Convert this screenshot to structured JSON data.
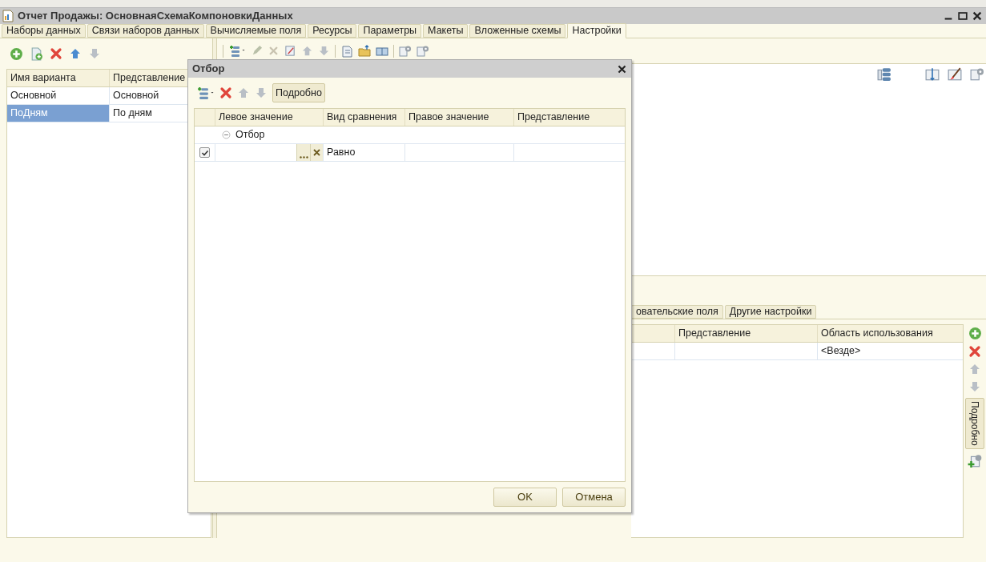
{
  "window": {
    "title": "Отчет Продажы: ОсновнаяСхемаКомпоновкиДанных"
  },
  "tabs": [
    {
      "label": "Наборы данных",
      "selected": false
    },
    {
      "label": "Связи наборов данных",
      "selected": false
    },
    {
      "label": "Вычисляемые поля",
      "selected": false
    },
    {
      "label": "Ресурсы",
      "selected": false
    },
    {
      "label": "Параметры",
      "selected": false
    },
    {
      "label": "Макеты",
      "selected": false
    },
    {
      "label": "Вложенные схемы",
      "selected": false
    },
    {
      "label": "Настройки",
      "selected": true
    }
  ],
  "variants": {
    "columns": [
      "Имя варианта",
      "Представление"
    ],
    "rows": [
      {
        "name": "Основной",
        "presentation": "Основной",
        "selected": false
      },
      {
        "name": "ПоДням",
        "presentation": "По дням",
        "selected": true
      }
    ]
  },
  "lower_panel": {
    "tabs": [
      {
        "label": "овательские поля",
        "selected": false
      },
      {
        "label": "Другие настройки",
        "selected": false
      }
    ],
    "columns": [
      "Представление",
      "Область использования"
    ],
    "rows": [
      {
        "usage": "<Везде>"
      }
    ],
    "side_button": "Подробно"
  },
  "dialog": {
    "title": "Отбор",
    "details_button": "Подробно",
    "columns": [
      "Левое значение",
      "Вид сравнения",
      "Правое значение",
      "Представление"
    ],
    "rows": [
      {
        "kind": "group",
        "label": "Отбор",
        "expanded": true
      },
      {
        "kind": "condition",
        "checked": true,
        "comparison": "Равно"
      }
    ],
    "buttons": [
      "OK",
      "Отмена"
    ]
  }
}
